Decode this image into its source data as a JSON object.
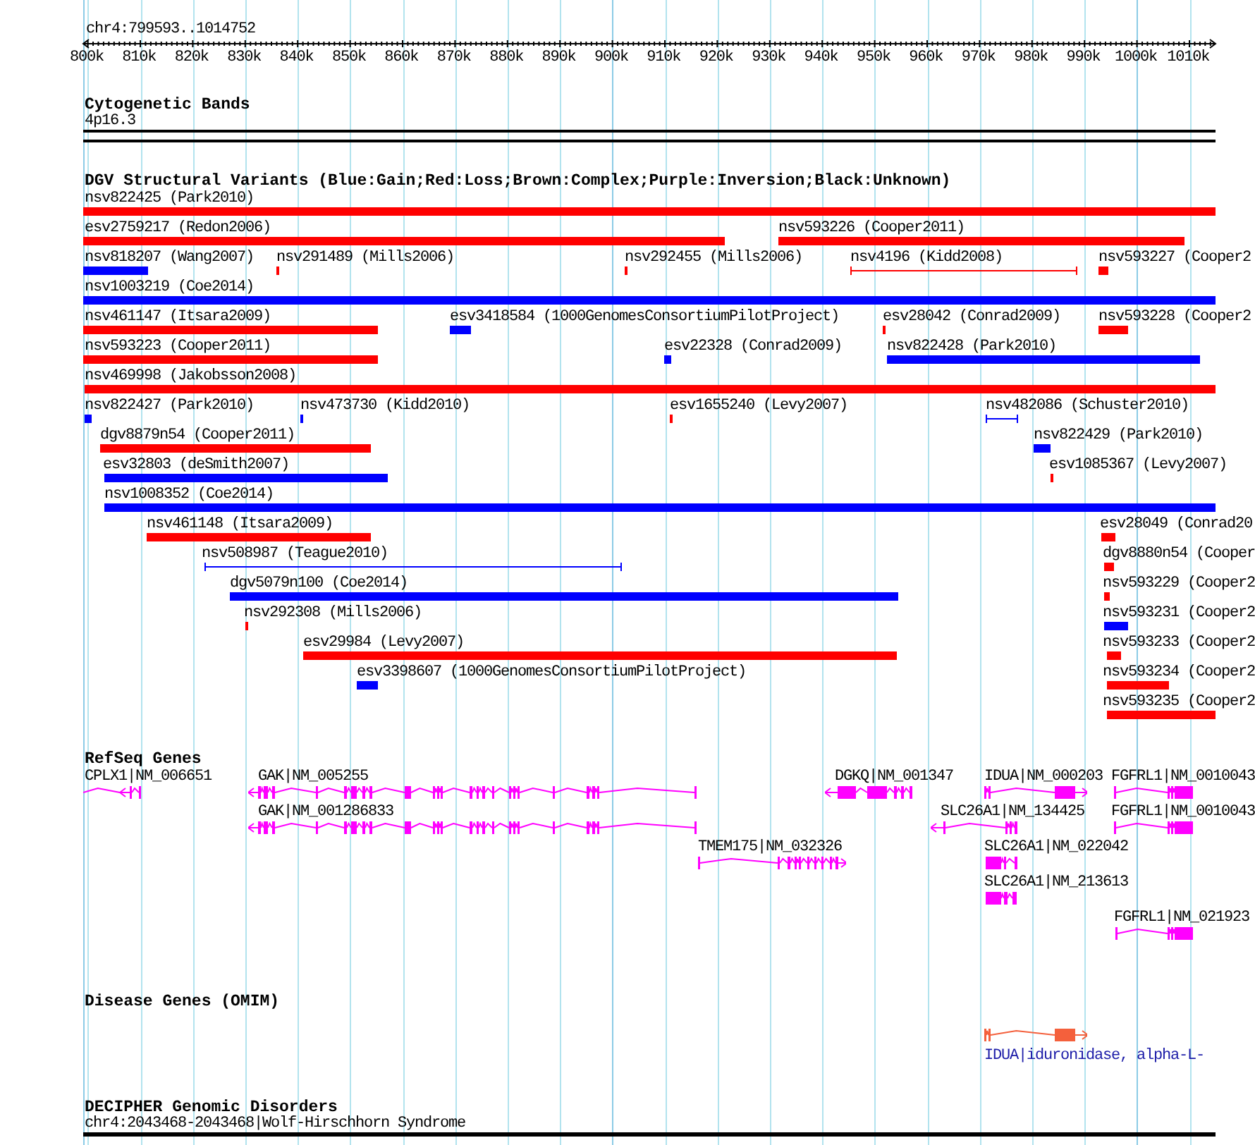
{
  "ruler": {
    "position": "chr4:799593..1014752",
    "ticks": [
      "800k",
      "810k",
      "820k",
      "830k",
      "840k",
      "850k",
      "860k",
      "870k",
      "880k",
      "890k",
      "900k",
      "910k",
      "920k",
      "930k",
      "940k",
      "950k",
      "960k",
      "970k",
      "980k",
      "990k",
      "1000k",
      "1010k"
    ]
  },
  "cytogenetic_bands": {
    "title": "Cytogenetic Bands",
    "bands": [
      {
        "label": "4p16.3"
      }
    ]
  },
  "dgv_variants": {
    "title": "DGV Structural Variants (Blue:Gain;Red:Loss;Brown:Complex;Purple:Inversion;Black:Unknown)",
    "rows": [
      {
        "features": [
          {
            "label": "nsv822425 (Park2010)",
            "kind": "bar",
            "color": "#ff0000"
          }
        ]
      },
      {
        "features": [
          {
            "label": "esv2759217 (Redon2006)",
            "kind": "bar",
            "color": "#ff0000"
          },
          {
            "label": "nsv593226 (Cooper2011)",
            "kind": "bar",
            "color": "#ff0000"
          }
        ]
      },
      {
        "features": [
          {
            "label": "nsv818207 (Wang2007)",
            "kind": "bar",
            "color": "#0000ff"
          },
          {
            "label": "nsv291489 (Mills2006)",
            "kind": "bar",
            "color": "#ff0000"
          },
          {
            "label": "nsv292455 (Mills2006)",
            "kind": "bar",
            "color": "#ff0000"
          },
          {
            "label": "nsv4196 (Kidd2008)",
            "kind": "span",
            "color": "#ff0000"
          },
          {
            "label": "nsv593227 (Cooper2",
            "kind": "bar",
            "color": "#ff0000"
          }
        ]
      },
      {
        "features": [
          {
            "label": "nsv1003219 (Coe2014)",
            "kind": "bar",
            "color": "#0000ff"
          }
        ]
      },
      {
        "features": [
          {
            "label": "nsv461147 (Itsara2009)",
            "kind": "bar",
            "color": "#ff0000"
          },
          {
            "label": "esv3418584 (1000GenomesConsortiumPilotProject)",
            "kind": "bar",
            "color": "#0000ff"
          },
          {
            "label": "esv28042 (Conrad2009)",
            "kind": "bar",
            "color": "#ff0000"
          },
          {
            "label": "nsv593228 (Cooper2",
            "kind": "bar",
            "color": "#ff0000"
          }
        ]
      },
      {
        "features": [
          {
            "label": "nsv593223 (Cooper2011)",
            "kind": "bar",
            "color": "#ff0000"
          },
          {
            "label": "esv22328 (Conrad2009)",
            "kind": "bar",
            "color": "#0000ff"
          },
          {
            "label": "nsv822428 (Park2010)",
            "kind": "bar",
            "color": "#0000ff"
          }
        ]
      },
      {
        "features": [
          {
            "label": "nsv469998 (Jakobsson2008)",
            "kind": "bar",
            "color": "#ff0000"
          }
        ]
      },
      {
        "features": [
          {
            "label": "nsv822427 (Park2010)",
            "kind": "bar",
            "color": "#0000ff"
          },
          {
            "label": "nsv473730 (Kidd2010)",
            "kind": "bar",
            "color": "#0000ff"
          },
          {
            "label": "esv1655240 (Levy2007)",
            "kind": "bar",
            "color": "#ff0000"
          },
          {
            "label": "nsv482086 (Schuster2010)",
            "kind": "span",
            "color": "#0000ff"
          }
        ]
      },
      {
        "features": [
          {
            "label": "dgv8879n54 (Cooper2011)",
            "kind": "bar",
            "color": "#ff0000"
          },
          {
            "label": "nsv822429 (Park2010)",
            "kind": "bar",
            "color": "#0000ff"
          }
        ]
      },
      {
        "features": [
          {
            "label": "esv32803 (deSmith2007)",
            "kind": "bar",
            "color": "#0000ff"
          },
          {
            "label": "esv1085367 (Levy2007)",
            "kind": "bar",
            "color": "#ff0000"
          }
        ]
      },
      {
        "features": [
          {
            "label": "nsv1008352 (Coe2014)",
            "kind": "bar",
            "color": "#0000ff"
          }
        ]
      },
      {
        "features": [
          {
            "label": "nsv461148 (Itsara2009)",
            "kind": "bar",
            "color": "#ff0000"
          },
          {
            "label": "esv28049 (Conrad20",
            "kind": "bar",
            "color": "#ff0000"
          }
        ]
      },
      {
        "features": [
          {
            "label": "nsv508987 (Teague2010)",
            "kind": "span",
            "color": "#0000ff"
          },
          {
            "label": "dgv8880n54 (Cooper",
            "kind": "bar",
            "color": "#ff0000"
          }
        ]
      },
      {
        "features": [
          {
            "label": "dgv5079n100 (Coe2014)",
            "kind": "bar",
            "color": "#0000ff"
          },
          {
            "label": "nsv593229 (Cooper2",
            "kind": "bar",
            "color": "#ff0000"
          }
        ]
      },
      {
        "features": [
          {
            "label": "nsv292308 (Mills2006)",
            "kind": "bar",
            "color": "#ff0000"
          },
          {
            "label": "nsv593231 (Cooper2",
            "kind": "bar",
            "color": "#0000ff"
          }
        ]
      },
      {
        "features": [
          {
            "label": "esv29984 (Levy2007)",
            "kind": "bar",
            "color": "#ff0000"
          },
          {
            "label": "nsv593233 (Cooper2",
            "kind": "bar",
            "color": "#ff0000"
          }
        ]
      },
      {
        "features": [
          {
            "label": "esv3398607 (1000GenomesConsortiumPilotProject)",
            "kind": "bar",
            "color": "#0000ff"
          },
          {
            "label": "nsv593234 (Cooper2",
            "kind": "bar",
            "color": "#ff0000"
          }
        ]
      },
      {
        "features": [
          {
            "label": "nsv593235 (Cooper2",
            "kind": "bar",
            "color": "#ff0000"
          }
        ]
      }
    ]
  },
  "refseq_genes": {
    "title": "RefSeq Genes",
    "rows": [
      {
        "genes": [
          {
            "label": "CPLX1|NM_006651",
            "kind": "reverse"
          },
          {
            "label": "GAK|NM_005255",
            "kind": "reverse"
          },
          {
            "label": "DGKQ|NM_001347",
            "kind": "reverse"
          },
          {
            "label": "IDUA|NM_000203",
            "kind": "forward"
          },
          {
            "label": "FGFRL1|NM_0010043",
            "kind": "plain"
          }
        ]
      },
      {
        "genes": [
          {
            "label": "GAK|NM_001286833",
            "kind": "reverse"
          },
          {
            "label": "SLC26A1|NM_134425",
            "kind": "reverse"
          },
          {
            "label": "FGFRL1|NM_0010043",
            "kind": "plain"
          }
        ]
      },
      {
        "genes": [
          {
            "label": "TMEM175|NM_032326",
            "kind": "forward"
          },
          {
            "label": "SLC26A1|NM_022042",
            "kind": "plain"
          }
        ]
      },
      {
        "genes": [
          {
            "label": "SLC26A1|NM_213613",
            "kind": "plain"
          }
        ]
      },
      {
        "genes": [
          {
            "label": "FGFRL1|NM_021923",
            "kind": "plain"
          }
        ]
      }
    ]
  },
  "disease_genes": {
    "title": "Disease Genes (OMIM)",
    "genes": [
      {
        "label": "IDUA|iduronidase, alpha-L-",
        "kind": "forward"
      }
    ]
  },
  "genomic_disorders": {
    "title": "DECIPHER Genomic Disorders",
    "features": [
      {
        "label": "chr4:2043468-2043468|Wolf-Hirschhorn Syndrome"
      }
    ]
  }
}
